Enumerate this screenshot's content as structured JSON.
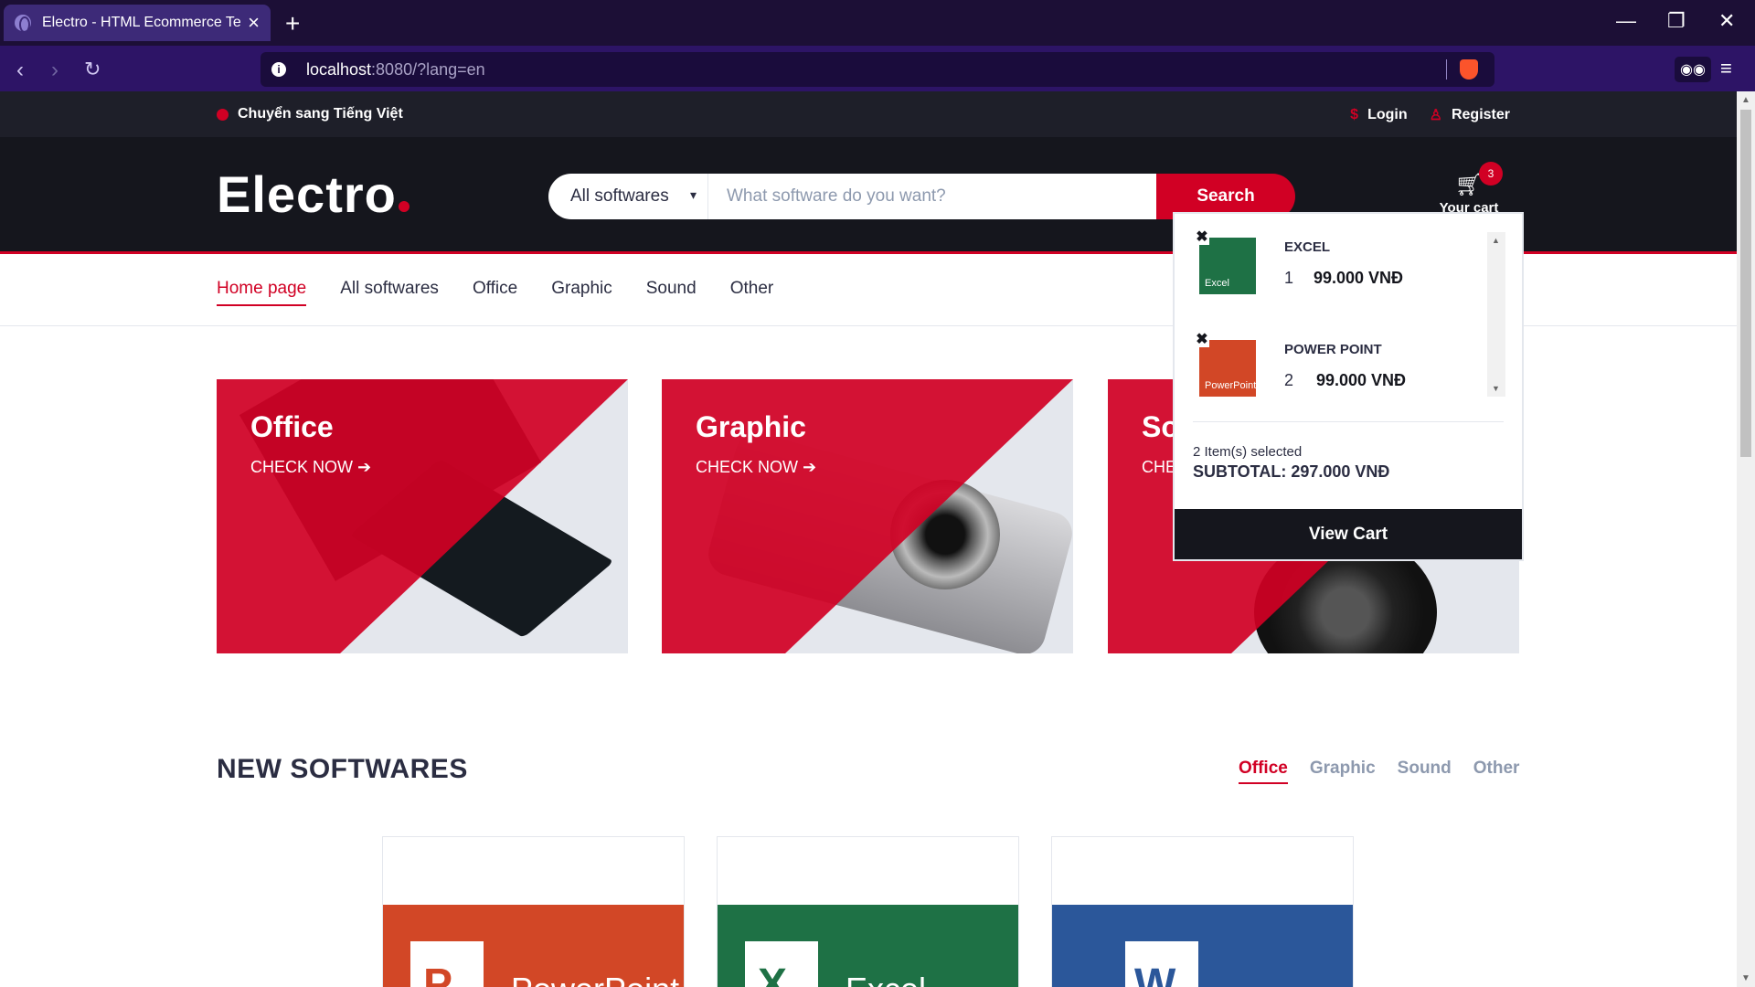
{
  "browser": {
    "tab_title": "Electro - HTML Ecommerce Ten",
    "new_tab": "+",
    "url_host": "localhost",
    "url_rest": ":8080/?lang=en"
  },
  "top_header": {
    "language_switch": "Chuyển sang Tiếng Việt",
    "login": "Login",
    "register": "Register"
  },
  "header": {
    "logo": "Electro",
    "search_category": "All softwares",
    "search_placeholder": "What software do you want?",
    "search_button": "Search",
    "cart_label": "Your cart",
    "cart_count": "3"
  },
  "nav": {
    "items": [
      "Home page",
      "All softwares",
      "Office",
      "Graphic",
      "Sound",
      "Other"
    ]
  },
  "shops": [
    {
      "title": "Office",
      "cta": "CHECK NOW ➔"
    },
    {
      "title": "Graphic",
      "cta": "CHECK NOW ➔"
    },
    {
      "title": "So",
      "cta": "CHE"
    }
  ],
  "cart_dropdown": {
    "items": [
      {
        "name": "EXCEL",
        "qty": "1",
        "price": "99.000 VNĐ",
        "thumb_label": "Excel",
        "thumb_color": "#1e7145"
      },
      {
        "name": "POWER POINT",
        "qty": "2",
        "price": "99.000 VNĐ",
        "thumb_label": "PowerPoint",
        "thumb_color": "#d24726"
      }
    ],
    "items_selected": "2 Item(s) selected",
    "subtotal": "SUBTOTAL: 297.000 VNĐ",
    "view_cart": "View Cart"
  },
  "new_softwares": {
    "title": "NEW SOFTWARES",
    "tabs": [
      "Office",
      "Graphic",
      "Sound",
      "Other"
    ],
    "products": [
      {
        "name": "PowerPoint",
        "letter": "P",
        "color": "#d24726"
      },
      {
        "name": "Excel",
        "letter": "X",
        "color": "#1e7145"
      },
      {
        "name": "",
        "letter": "W",
        "color": "#2b579a"
      }
    ]
  },
  "colors": {
    "accent": "#d10024",
    "dark": "#15161d",
    "browser_bg": "#2d1466"
  }
}
